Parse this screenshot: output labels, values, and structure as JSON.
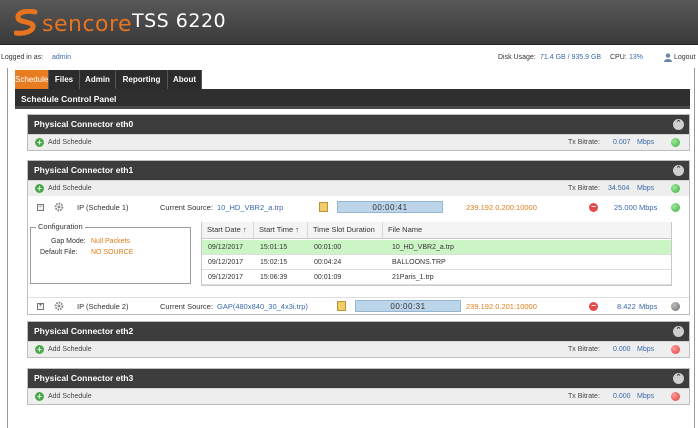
{
  "header": {
    "brand": "sencore",
    "product": "TSS 6220"
  },
  "session": {
    "logged_in_label": "Logged in as:",
    "user": "admin",
    "disk_label": "Disk Usage:",
    "disk_value": "71.4 GB / 935.9 GB",
    "cpu_label": "CPU:",
    "cpu_value": "13%",
    "logout_label": "Logout"
  },
  "tabs": [
    "Schedule",
    "Files",
    "Admin",
    "Reporting",
    "About"
  ],
  "panel_title": "Schedule Control Panel",
  "add_schedule_label": "Add Schedule",
  "tx_bitrate_label": "Tx Bitrate:",
  "units": "Mbps",
  "connectors": [
    {
      "title": "Physical Connector eth0",
      "bitrate": "0.007",
      "status": "green"
    },
    {
      "title": "Physical Connector eth1",
      "bitrate": "34.504",
      "status": "green",
      "schedules": [
        {
          "name": "IP (Schedule 1)",
          "source_label": "Current Source:",
          "source": "10_HD_VBR2_a.trp",
          "timer": "00:00:41",
          "multicast": "239.192.0.200:10000",
          "rate": "25.000",
          "status": "green",
          "config": {
            "legend": "Configuration",
            "gap_label": "Gap Mode:",
            "gap_value": "Null Packets",
            "default_label": "Default File:",
            "default_value": "NO SOURCE"
          },
          "table": {
            "columns": [
              "Start Date ↑",
              "Start Time ↑",
              "Time Slot Duration",
              "File Name"
            ],
            "rows": [
              [
                "09/12/2017",
                "15:01:15",
                "00:01:00",
                "10_HD_VBR2_a.trp"
              ],
              [
                "09/12/2017",
                "15:02:15",
                "00:04:24",
                "BALLOONS.TRP"
              ],
              [
                "09/12/2017",
                "15:06:39",
                "00:01:09",
                "21Paris_1.trp"
              ]
            ]
          }
        },
        {
          "name": "IP (Schedule 2)",
          "source_label": "Current Source:",
          "source": "GAP(480x840_30_4x3i.trp)",
          "timer": "00:00:31",
          "multicast": "239.192.0.201:10000",
          "rate": "8.422",
          "status": "gray"
        }
      ]
    },
    {
      "title": "Physical Connector eth2",
      "bitrate": "0.000",
      "status": "red"
    },
    {
      "title": "Physical Connector eth3",
      "bitrate": "0.000",
      "status": "red"
    }
  ],
  "colors": {
    "accent": "#e87c21",
    "link": "#3a6aa8",
    "header_bg": "#3d3d3d"
  }
}
